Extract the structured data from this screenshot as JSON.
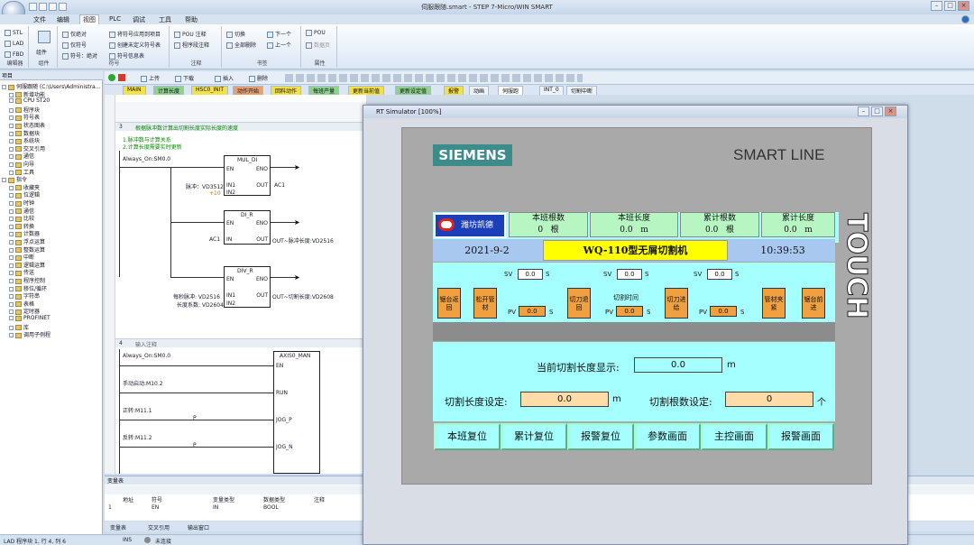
{
  "window": {
    "title": "伺服跟随.smart - STEP 7-Micro/WIN SMART"
  },
  "menu": [
    "文件",
    "编辑",
    "视图",
    "PLC",
    "调试",
    "工具",
    "帮助"
  ],
  "ribbon": {
    "groups": [
      {
        "label": "编辑器",
        "items": [
          "STL",
          "LAD",
          "FBD"
        ]
      },
      {
        "label": "组件",
        "items": [
          "组件"
        ]
      },
      {
        "label": "符号",
        "items": [
          "仅绝对",
          "仅符号",
          "符号：绝对",
          "将符号应用到项目",
          "创建未定义符号表",
          "符号信息表"
        ]
      },
      {
        "label": "注释",
        "items": [
          "POU 注释",
          "程序段注释"
        ]
      },
      {
        "label": "书签",
        "items": [
          "切换",
          "全部删除",
          "下一个",
          "上一个"
        ]
      },
      {
        "label": "属性",
        "items": [
          "POU",
          "数据页"
        ]
      }
    ]
  },
  "left_pane": {
    "header": "项目",
    "items": [
      "伺服跟随 (C:\\Users\\Administra...",
      "新增功能",
      "CPU ST20",
      "程序块",
      "符号表",
      "状态图表",
      "数据块",
      "系统块",
      "交叉引用",
      "通信",
      "向导",
      "工具",
      "指令",
      "收藏夹",
      "位逻辑",
      "时钟",
      "通信",
      "比较",
      "转换",
      "计数器",
      "浮点运算",
      "整数运算",
      "中断",
      "逻辑运算",
      "传送",
      "程序控制",
      "移位/循环",
      "字符串",
      "表格",
      "定时器",
      "PROFINET",
      "库",
      "调用子例程"
    ]
  },
  "editor_toolbar": [
    "上传",
    "下载",
    "插入",
    "删除"
  ],
  "tabs": [
    "MAIN",
    "计算长度",
    "HSC0_INIT",
    "动作开始",
    "回料动作",
    "每班产量",
    "更新当前值",
    "更新设定值",
    "报警",
    "动画",
    "伺服跑",
    "INT_0",
    "切割中断"
  ],
  "ladder": {
    "net3_title": "3",
    "net3_comment": "根据脉冲数计算出切割长度实际长度的速度",
    "net3_comment2": "1.脉冲数与计算关系",
    "net3_comment3": "2.计算长度需要实时更新",
    "always_on": "Always_On:SM0.0",
    "di_r": "DI_R",
    "en": "EN",
    "eno": "ENO",
    "mul_di": "MUL_DI",
    "div_r": "DIV_R",
    "in1": "IN1",
    "in2": "IN2",
    "in": "IN",
    "out": "OUT",
    "l1": "脉冲：VD3512",
    "l2": "+10",
    "l3": "AC1",
    "l4": "AC1",
    "l5": "OUT~脉冲长度:VD2516",
    "l6": "每秒脉冲: VD2516",
    "l7": "长度系数: VD2604",
    "l8": "OUT~切割长度:VD2608",
    "net4_title": "4",
    "net4_comment": "输入注释",
    "always_on2": "Always_On:SM0.0",
    "axis0_man": "AXIS0_MAN",
    "run": "RUN",
    "jog_p": "JOG_P",
    "jog_n": "JOG_N",
    "m0_2": "手动启动:M10.2",
    "m11_1": "正转:M11.1",
    "m11_2": "反转:M11.2",
    "p": "P"
  },
  "var_table": {
    "header": "变量表",
    "cols": [
      "地址",
      "符号",
      "变量类型",
      "数据类型",
      "注释"
    ],
    "row": [
      "1",
      "EN",
      "IN",
      "BOOL",
      ""
    ]
  },
  "bottom_tabs": [
    "变量表",
    "交叉引用",
    "输出窗口"
  ],
  "status": {
    "mode": "LAD 程序块 1, 行 4, 列 6",
    "ins": "INS",
    "conn": "未连接"
  },
  "sim": {
    "title": "RT Simulator [100%]",
    "brand": "SIEMENS",
    "line": "SMART LINE",
    "touch": "TOUCH",
    "logo_text": "潍坊凯德",
    "headers": [
      {
        "label": "本班根数",
        "value": "0",
        "unit": "根"
      },
      {
        "label": "本班长度",
        "value": "0.0",
        "unit": "m"
      },
      {
        "label": "累计根数",
        "value": "0.0",
        "unit": "根"
      },
      {
        "label": "累计长度",
        "value": "0.0",
        "unit": "m"
      }
    ],
    "date": "2021-9-2",
    "machine": "WQ-110型无屑切割机",
    "time": "10:39:53",
    "sv": "SV",
    "pv": "PV",
    "s": "S",
    "sv_values": [
      "0.0",
      "0.0",
      "0.0"
    ],
    "pv_values": [
      "0.0",
      "0.0",
      "0.0"
    ],
    "cut_time": "切割时间",
    "buttons": [
      "锯台返回",
      "松开管材",
      "切刀退回",
      "切刀进给",
      "管材夹紧",
      "锯台前进"
    ],
    "cur_len_label": "当前切割长度显示:",
    "cur_len_value": "0.0",
    "cur_len_unit": "m",
    "set_len_label": "切割长度设定:",
    "set_len_value": "0.0",
    "set_len_unit": "m",
    "set_cnt_label": "切割根数设定:",
    "set_cnt_value": "0",
    "set_cnt_unit": "个",
    "nav": [
      "本班复位",
      "累计复位",
      "报警复位",
      "参数画面",
      "主控画面",
      "报警画面"
    ],
    "colors": {
      "screen": "#a6ffff",
      "button": "#f0a040",
      "header": "#b7f5c2",
      "machine": "#ffff00",
      "dateRow": "#a8c8f0",
      "brand": "#3c8c8c"
    }
  }
}
